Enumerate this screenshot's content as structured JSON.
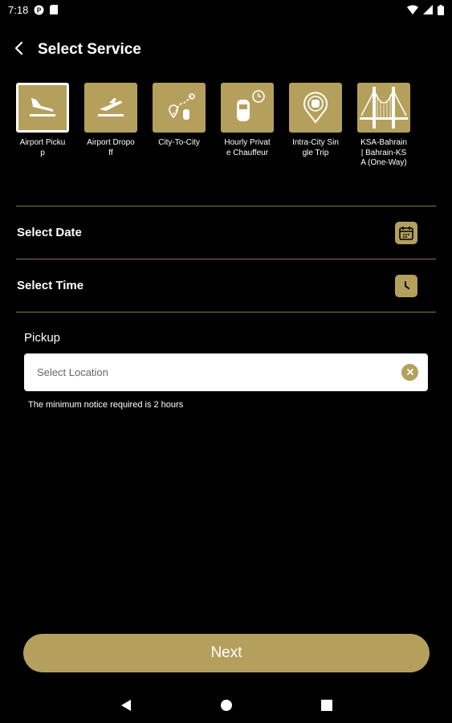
{
  "status_bar": {
    "time": "7:18"
  },
  "header": {
    "title": "Select Service"
  },
  "services": [
    {
      "label": "Airport Pickup",
      "icon": "airplane-landing-icon",
      "selected": true
    },
    {
      "label": "Airport Dropoff",
      "icon": "airplane-takeoff-icon",
      "selected": false
    },
    {
      "label": "City-To-City",
      "icon": "route-icon",
      "selected": false
    },
    {
      "label": "Hourly Private Chauffeur",
      "icon": "car-clock-icon",
      "selected": false
    },
    {
      "label": "Intra-City Single Trip",
      "icon": "car-pin-icon",
      "selected": false
    },
    {
      "label": "KSA-Bahrain | Bahrain-KSA (One-Way)",
      "icon": "bridge-icon",
      "selected": false
    }
  ],
  "form": {
    "date_label": "Select Date",
    "time_label": "Select Time",
    "pickup_label": "Pickup",
    "pickup_placeholder": "Select Location",
    "pickup_value": "",
    "notice": "The minimum notice required is 2 hours"
  },
  "next_button": {
    "label": "Next"
  },
  "colors": {
    "accent": "#b4a05c",
    "background": "#000000",
    "divider": "#8a7a44"
  }
}
